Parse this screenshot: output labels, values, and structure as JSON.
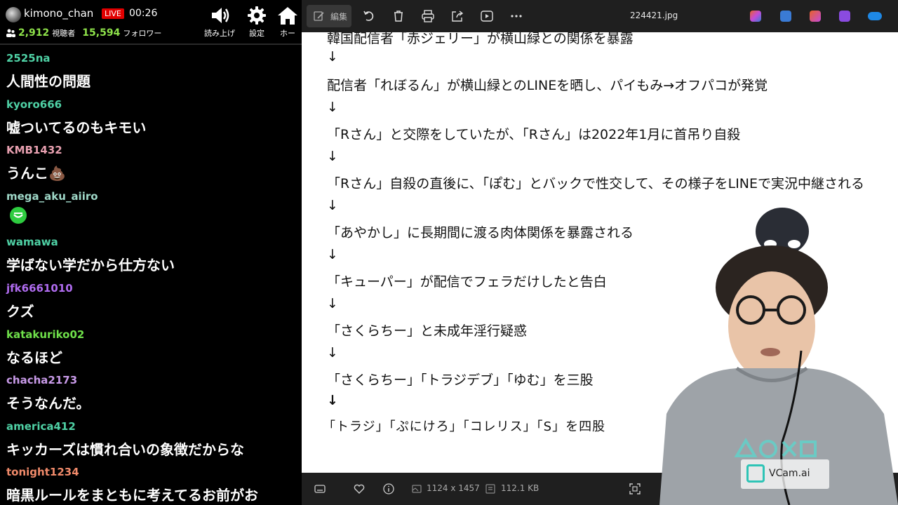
{
  "stream": {
    "channel": "kimono_chan",
    "live_label": "LIVE",
    "elapsed": "00:26",
    "viewers": "2,912",
    "viewers_label": "視聴者",
    "followers": "15,594",
    "followers_label": "フォロワー",
    "buttons": [
      {
        "label": "読み上げ",
        "icon": "speaker-icon"
      },
      {
        "label": "設定",
        "icon": "gear-icon"
      },
      {
        "label": "ホー",
        "icon": "home-icon"
      }
    ]
  },
  "chat": [
    {
      "user": "2525na",
      "color": "#4fd1a5",
      "text": "人間性の問題"
    },
    {
      "user": "kyoro666",
      "color": "#4fd1a5",
      "text": "嘘ついてるのもキモい"
    },
    {
      "user": "KMB1432",
      "color": "#e8a0b0",
      "text": "うんこ💩"
    },
    {
      "user": "mega_aku_aiiro",
      "color": "#9fd8c8",
      "text": ""
    },
    {
      "user": "wamawa",
      "color": "#4fd1a5",
      "text": "学ばない学だから仕方ない"
    },
    {
      "user": "jfk6661010",
      "color": "#b06cf0",
      "text": "クズ"
    },
    {
      "user": "katakuriko02",
      "color": "#6fe04a",
      "text": "なるほど"
    },
    {
      "user": "chacha2173",
      "color": "#c89ae8",
      "text": "そうなんだ。"
    },
    {
      "user": "america412",
      "color": "#4fd1a5",
      "text": "キッカーズは慣れ合いの象徴だからな"
    },
    {
      "user": "tonight1234",
      "color": "#f08a6a",
      "text": "暗黒ルールをまともに考えてるお前がお"
    }
  ],
  "viewer": {
    "edit_label": "編集",
    "file_name": "224421.jpg",
    "dimensions": "1124 x 1457",
    "file_size": "112.1 KB",
    "accent_colors": [
      "#e8622a",
      "#3a7bd5",
      "#c44bd8",
      "#8a4be0",
      "#1e88e5"
    ]
  },
  "document": {
    "lines": [
      "韓国配信者「赤ジェリー」が横山緑との関係を暴露",
      "↓",
      "配信者「れぼるん」が横山緑とのLINEを晒し、パイもみ→オフパコが発覚",
      "↓",
      "「Rさん」と交際をしていたが、「Rさん」は2022年1月に首吊り自殺",
      "↓",
      "「Rさん」自殺の直後に、「ぽむ」とバックで性交して、その様子をLINEで実況中継される",
      "↓",
      "「あやかし」に長期間に渡る肉体関係を暴露される",
      "↓",
      "「キューパー」が配信でフェラだけしたと告白",
      "↓",
      "「さくらちー」と未成年淫行疑惑",
      "↓",
      "「さくらちー」「トラジデブ」「ゆむ」を三股",
      "↓",
      "「トラジ」「ぷにけろ」「コレリス」「S」を四股"
    ]
  },
  "webcam": {
    "brand": "VCam.ai"
  }
}
